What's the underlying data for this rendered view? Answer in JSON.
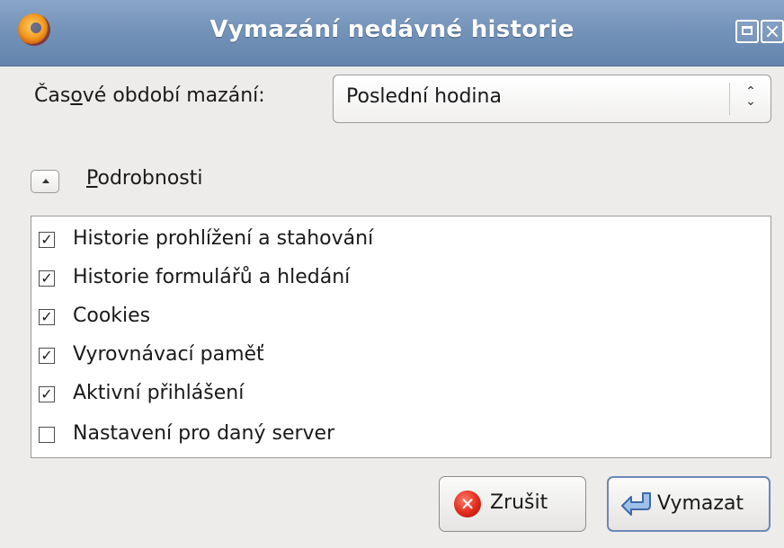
{
  "window": {
    "title": "Vymazání nedávné historie"
  },
  "period": {
    "label_before": "Čas",
    "label_underlined": "o",
    "label_after": "vé období mazání:",
    "selected": "Poslední hodina",
    "arrows": "⌃⌄"
  },
  "details": {
    "label_underlined": "P",
    "label_rest": "odrobnosti",
    "expanded": true
  },
  "items": [
    {
      "label": "Historie prohlížení a stahování",
      "checked": true
    },
    {
      "label": "Historie formulářů a hledání",
      "checked": true
    },
    {
      "label": "Cookies",
      "checked": true
    },
    {
      "label": "Vyrovnávací paměť",
      "checked": true
    },
    {
      "label": "Aktivní přihlášení",
      "checked": true
    },
    {
      "label": "Nastavení pro daný server",
      "checked": false
    }
  ],
  "buttons": {
    "cancel": "Zrušit",
    "clear": "Vymazat"
  },
  "icons": {
    "app": "firefox-icon",
    "cancel": "cancel-x-icon",
    "clear": "enter-arrow-icon",
    "maximize": "maximize-icon",
    "close": "close-icon"
  }
}
